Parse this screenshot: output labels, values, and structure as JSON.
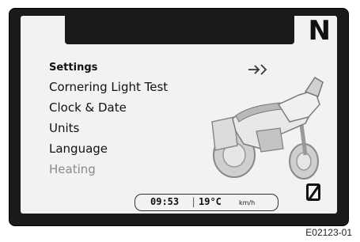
{
  "display": {
    "gear": "N",
    "menu": {
      "title": "Settings",
      "items": [
        {
          "label": "Cornering Light Test",
          "dimmed": false
        },
        {
          "label": "Clock & Date",
          "dimmed": false
        },
        {
          "label": "Units",
          "dimmed": false
        },
        {
          "label": "Language",
          "dimmed": false
        },
        {
          "label": "Heating",
          "dimmed": true
        }
      ]
    },
    "status_bar": {
      "time": "09:53",
      "separator": "|",
      "temperature": "19°C",
      "speed_unit": "km/h"
    }
  },
  "figure_id": "E02123-01",
  "colors": {
    "screen_bg": "#f2f2f2",
    "frame": "#1a1a1a",
    "dim_text": "#8a8a8a"
  }
}
